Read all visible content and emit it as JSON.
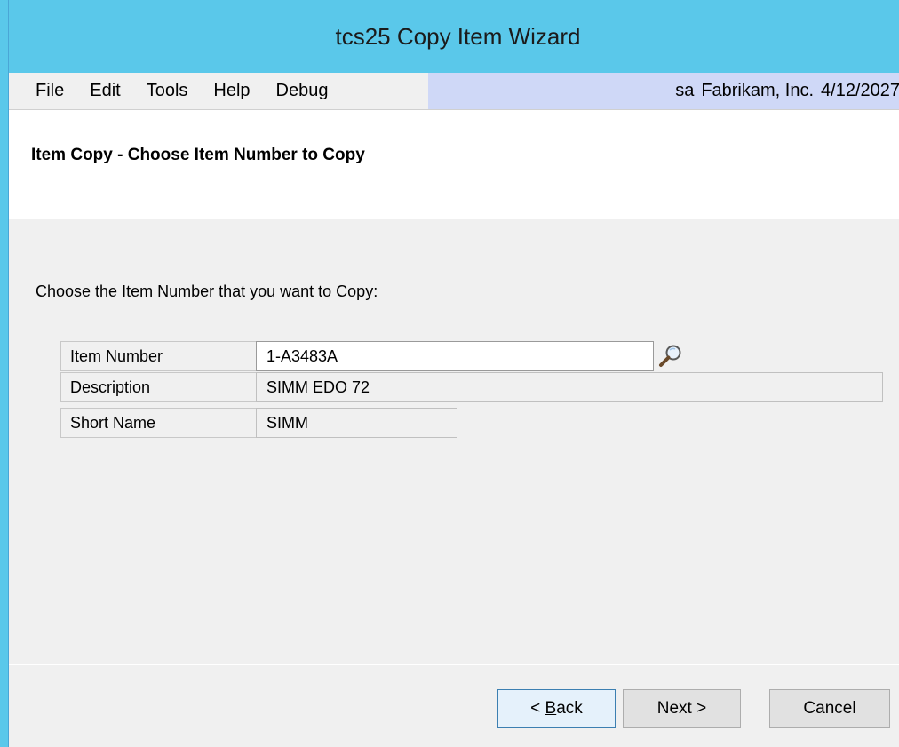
{
  "window": {
    "title": "tcs25 Copy Item Wizard"
  },
  "menubar": {
    "items": [
      "File",
      "Edit",
      "Tools",
      "Help",
      "Debug"
    ],
    "status": {
      "user": "sa",
      "company": "Fabrikam, Inc.",
      "date": "4/12/2027"
    }
  },
  "header": {
    "heading": "Item Copy - Choose Item Number to Copy"
  },
  "form": {
    "instruction": "Choose the Item Number that you want to Copy:",
    "fields": [
      {
        "label": "Item Number",
        "value": "1-A3483A"
      },
      {
        "label": "Description",
        "value": "SIMM EDO 72"
      },
      {
        "label": "Short Name",
        "value": "SIMM"
      }
    ]
  },
  "buttons": {
    "back_prefix": "< ",
    "back_mnemonic": "B",
    "back_rest": "ack",
    "next": "Next >",
    "cancel": "Cancel"
  },
  "icons": {
    "lookup": "magnifier-icon"
  }
}
